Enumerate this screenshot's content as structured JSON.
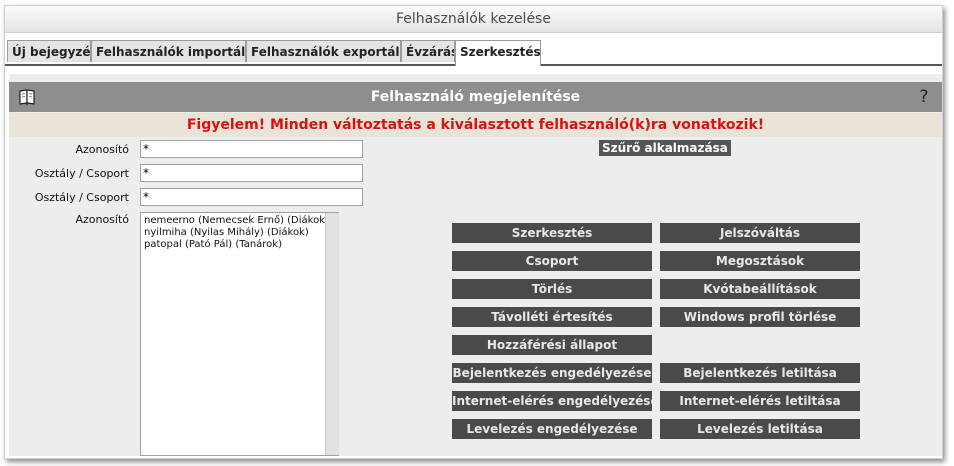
{
  "window": {
    "title": "Felhasználók kezelése"
  },
  "tabs": [
    {
      "label": "Új bejegyzés"
    },
    {
      "label": "Felhasználók importálása"
    },
    {
      "label": "Felhasználók exportálása"
    },
    {
      "label": "Évzárás"
    },
    {
      "label": "Szerkesztés",
      "active": true
    }
  ],
  "panel": {
    "title": "Felhasználó megjelenítése",
    "help": "?",
    "warning": "Figyelem! Minden változtatás a kiválasztott felhasználó(k)ra vonatkozik!"
  },
  "filter": {
    "fields": [
      {
        "label": "Azonosító",
        "value": "*"
      },
      {
        "label": "Osztály / Csoport",
        "value": "*"
      },
      {
        "label": "Osztály / Csoport",
        "value": "*"
      }
    ],
    "list_label": "Azonosító",
    "list_items": [
      "nemeerno (Nemecsek Ernő) (Diákok)",
      "nyilmiha (Nyilas Mihály) (Diákok)",
      "patopal (Pató Pál) (Tanárok)"
    ],
    "apply_button": "Szűrő alkalmazása"
  },
  "actions": {
    "edit": "Szerkesztés",
    "password_change": "Jelszóváltás",
    "group": "Csoport",
    "shares": "Megosztások",
    "delete": "Törlés",
    "quota": "Kvótabeállítások",
    "away_notice": "Távolléti értesítés",
    "windows_profile_delete": "Windows profil törlése",
    "access_status": "Hozzáférési állapot",
    "login_enable": "Bejelentkezés engedélyezése",
    "login_disable": "Bejelentkezés letiltása",
    "internet_enable": "Internet-elérés engedélyezése",
    "internet_disable": "Internet-elérés letiltása",
    "mail_enable": "Levelezés engedélyezése",
    "mail_disable": "Levelezés letiltása"
  },
  "icons": {
    "panel_icon": "book-icon",
    "help_icon": "question-mark-icon"
  },
  "colors": {
    "header_bg": "#8e8e8e",
    "warning_text": "#dd1010",
    "button_bg": "#4a4a4a"
  }
}
